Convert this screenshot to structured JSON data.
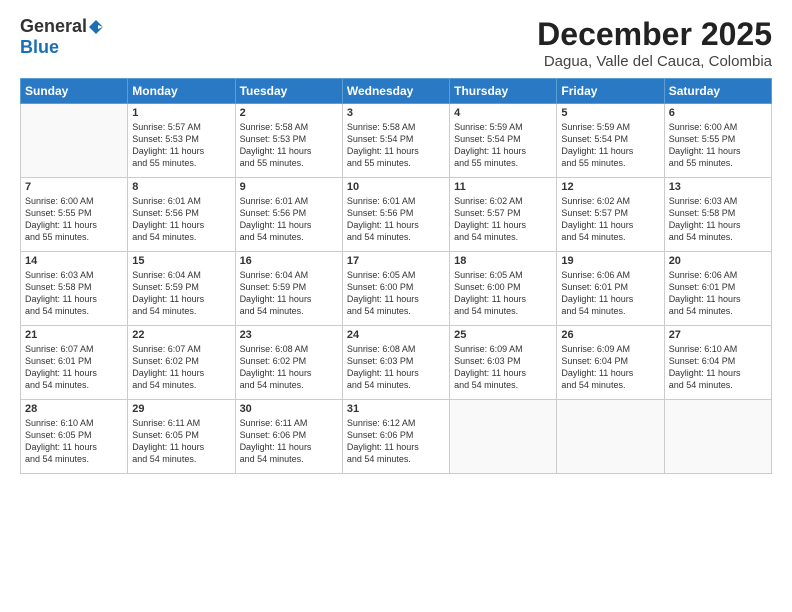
{
  "logo": {
    "general": "General",
    "blue": "Blue"
  },
  "header": {
    "title": "December 2025",
    "subtitle": "Dagua, Valle del Cauca, Colombia"
  },
  "weekdays": [
    "Sunday",
    "Monday",
    "Tuesday",
    "Wednesday",
    "Thursday",
    "Friday",
    "Saturday"
  ],
  "weeks": [
    [
      {
        "day": "",
        "info": ""
      },
      {
        "day": "1",
        "info": "Sunrise: 5:57 AM\nSunset: 5:53 PM\nDaylight: 11 hours\nand 55 minutes."
      },
      {
        "day": "2",
        "info": "Sunrise: 5:58 AM\nSunset: 5:53 PM\nDaylight: 11 hours\nand 55 minutes."
      },
      {
        "day": "3",
        "info": "Sunrise: 5:58 AM\nSunset: 5:54 PM\nDaylight: 11 hours\nand 55 minutes."
      },
      {
        "day": "4",
        "info": "Sunrise: 5:59 AM\nSunset: 5:54 PM\nDaylight: 11 hours\nand 55 minutes."
      },
      {
        "day": "5",
        "info": "Sunrise: 5:59 AM\nSunset: 5:54 PM\nDaylight: 11 hours\nand 55 minutes."
      },
      {
        "day": "6",
        "info": "Sunrise: 6:00 AM\nSunset: 5:55 PM\nDaylight: 11 hours\nand 55 minutes."
      }
    ],
    [
      {
        "day": "7",
        "info": "Sunrise: 6:00 AM\nSunset: 5:55 PM\nDaylight: 11 hours\nand 55 minutes."
      },
      {
        "day": "8",
        "info": "Sunrise: 6:01 AM\nSunset: 5:56 PM\nDaylight: 11 hours\nand 54 minutes."
      },
      {
        "day": "9",
        "info": "Sunrise: 6:01 AM\nSunset: 5:56 PM\nDaylight: 11 hours\nand 54 minutes."
      },
      {
        "day": "10",
        "info": "Sunrise: 6:01 AM\nSunset: 5:56 PM\nDaylight: 11 hours\nand 54 minutes."
      },
      {
        "day": "11",
        "info": "Sunrise: 6:02 AM\nSunset: 5:57 PM\nDaylight: 11 hours\nand 54 minutes."
      },
      {
        "day": "12",
        "info": "Sunrise: 6:02 AM\nSunset: 5:57 PM\nDaylight: 11 hours\nand 54 minutes."
      },
      {
        "day": "13",
        "info": "Sunrise: 6:03 AM\nSunset: 5:58 PM\nDaylight: 11 hours\nand 54 minutes."
      }
    ],
    [
      {
        "day": "14",
        "info": "Sunrise: 6:03 AM\nSunset: 5:58 PM\nDaylight: 11 hours\nand 54 minutes."
      },
      {
        "day": "15",
        "info": "Sunrise: 6:04 AM\nSunset: 5:59 PM\nDaylight: 11 hours\nand 54 minutes."
      },
      {
        "day": "16",
        "info": "Sunrise: 6:04 AM\nSunset: 5:59 PM\nDaylight: 11 hours\nand 54 minutes."
      },
      {
        "day": "17",
        "info": "Sunrise: 6:05 AM\nSunset: 6:00 PM\nDaylight: 11 hours\nand 54 minutes."
      },
      {
        "day": "18",
        "info": "Sunrise: 6:05 AM\nSunset: 6:00 PM\nDaylight: 11 hours\nand 54 minutes."
      },
      {
        "day": "19",
        "info": "Sunrise: 6:06 AM\nSunset: 6:01 PM\nDaylight: 11 hours\nand 54 minutes."
      },
      {
        "day": "20",
        "info": "Sunrise: 6:06 AM\nSunset: 6:01 PM\nDaylight: 11 hours\nand 54 minutes."
      }
    ],
    [
      {
        "day": "21",
        "info": "Sunrise: 6:07 AM\nSunset: 6:01 PM\nDaylight: 11 hours\nand 54 minutes."
      },
      {
        "day": "22",
        "info": "Sunrise: 6:07 AM\nSunset: 6:02 PM\nDaylight: 11 hours\nand 54 minutes."
      },
      {
        "day": "23",
        "info": "Sunrise: 6:08 AM\nSunset: 6:02 PM\nDaylight: 11 hours\nand 54 minutes."
      },
      {
        "day": "24",
        "info": "Sunrise: 6:08 AM\nSunset: 6:03 PM\nDaylight: 11 hours\nand 54 minutes."
      },
      {
        "day": "25",
        "info": "Sunrise: 6:09 AM\nSunset: 6:03 PM\nDaylight: 11 hours\nand 54 minutes."
      },
      {
        "day": "26",
        "info": "Sunrise: 6:09 AM\nSunset: 6:04 PM\nDaylight: 11 hours\nand 54 minutes."
      },
      {
        "day": "27",
        "info": "Sunrise: 6:10 AM\nSunset: 6:04 PM\nDaylight: 11 hours\nand 54 minutes."
      }
    ],
    [
      {
        "day": "28",
        "info": "Sunrise: 6:10 AM\nSunset: 6:05 PM\nDaylight: 11 hours\nand 54 minutes."
      },
      {
        "day": "29",
        "info": "Sunrise: 6:11 AM\nSunset: 6:05 PM\nDaylight: 11 hours\nand 54 minutes."
      },
      {
        "day": "30",
        "info": "Sunrise: 6:11 AM\nSunset: 6:06 PM\nDaylight: 11 hours\nand 54 minutes."
      },
      {
        "day": "31",
        "info": "Sunrise: 6:12 AM\nSunset: 6:06 PM\nDaylight: 11 hours\nand 54 minutes."
      },
      {
        "day": "",
        "info": ""
      },
      {
        "day": "",
        "info": ""
      },
      {
        "day": "",
        "info": ""
      }
    ]
  ]
}
